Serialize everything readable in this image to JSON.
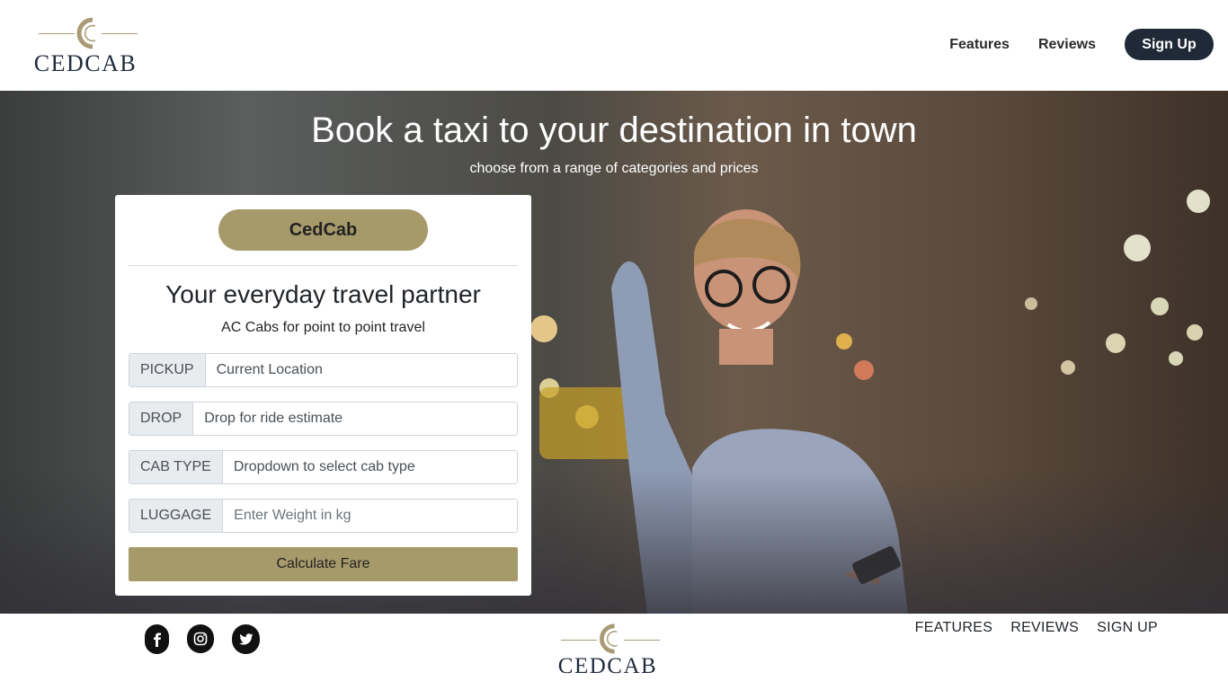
{
  "header": {
    "logo_text": "CEDCAB",
    "nav": {
      "features": "Features",
      "reviews": "Reviews",
      "signup": "Sign Up"
    }
  },
  "hero": {
    "title": "Book a taxi to your destination in town",
    "subtitle": "choose from a range of categories and prices"
  },
  "booking": {
    "brand_button": "CedCab",
    "title": "Your everyday travel partner",
    "tagline": "AC Cabs for point to point travel",
    "pickup": {
      "label": "PICKUP",
      "value": "Current Location"
    },
    "drop": {
      "label": "DROP",
      "value": "Drop for ride estimate"
    },
    "cab_type": {
      "label": "CAB TYPE",
      "value": "Dropdown to select cab type"
    },
    "luggage": {
      "label": "LUGGAGE",
      "placeholder": "Enter Weight in kg"
    },
    "calculate_button": "Calculate Fare"
  },
  "footer": {
    "social": [
      "facebook-icon",
      "instagram-icon",
      "twitter-icon"
    ],
    "logo_text": "CEDCAB",
    "nav": {
      "features": "FEATURES",
      "reviews": "REVIEWS",
      "signup": "SIGN UP"
    }
  },
  "colors": {
    "accent": "#a69a6b",
    "dark": "#1f2937",
    "logo_gold": "#a89a74"
  }
}
